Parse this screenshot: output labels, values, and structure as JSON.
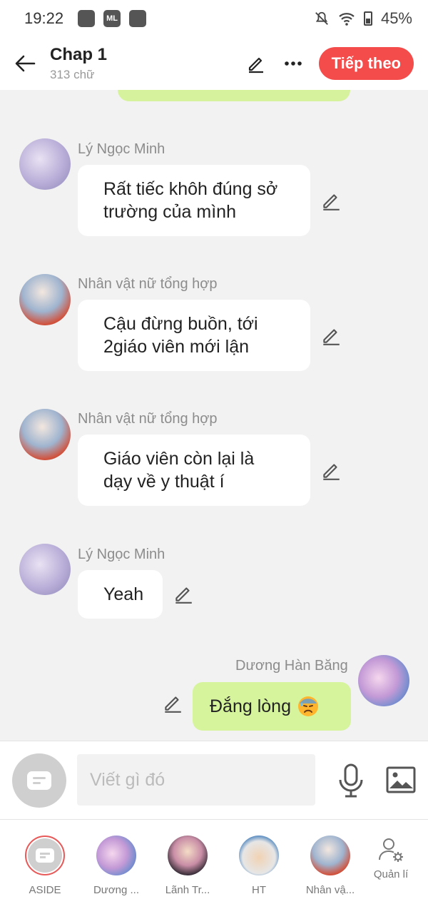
{
  "status_bar": {
    "time": "19:22",
    "battery": "45%",
    "app_icon_label": "ML"
  },
  "header": {
    "title": "Chap 1",
    "subtitle": "313 chữ",
    "next_label": "Tiếp theo"
  },
  "messages": [
    {
      "sender": "Lý Ngọc Minh",
      "lines": [
        "Rất tiếc khôh đúng sở",
        "trường của mình"
      ],
      "side": "left"
    },
    {
      "sender": "Nhân vật nữ tổng hợp",
      "lines": [
        "Cậu đừng buồn, tới",
        "2giáo viên mới lận"
      ],
      "side": "left"
    },
    {
      "sender": "Nhân vật nữ tổng hợp",
      "lines": [
        "Giáo viên còn lại là",
        "dạy về y thuật í"
      ],
      "side": "left"
    },
    {
      "sender": "Lý Ngọc Minh",
      "lines": [
        "Yeah"
      ],
      "side": "left"
    },
    {
      "sender": "Dương Hàn Băng",
      "lines": [
        "Đắng lòng"
      ],
      "emoji": "sad-sweat-emoji",
      "side": "right"
    }
  ],
  "composer": {
    "placeholder": "Viết gì đó"
  },
  "bottom_tabs": [
    {
      "label": "ASIDE"
    },
    {
      "label": "Dương ..."
    },
    {
      "label": "Lãnh Tr..."
    },
    {
      "label": "HT"
    },
    {
      "label": "Nhân vậ..."
    },
    {
      "label": "Quản lí"
    }
  ],
  "colors": {
    "accent": "#f44b4b",
    "my_bubble": "#d6f49c",
    "background": "#f2f2f2"
  }
}
